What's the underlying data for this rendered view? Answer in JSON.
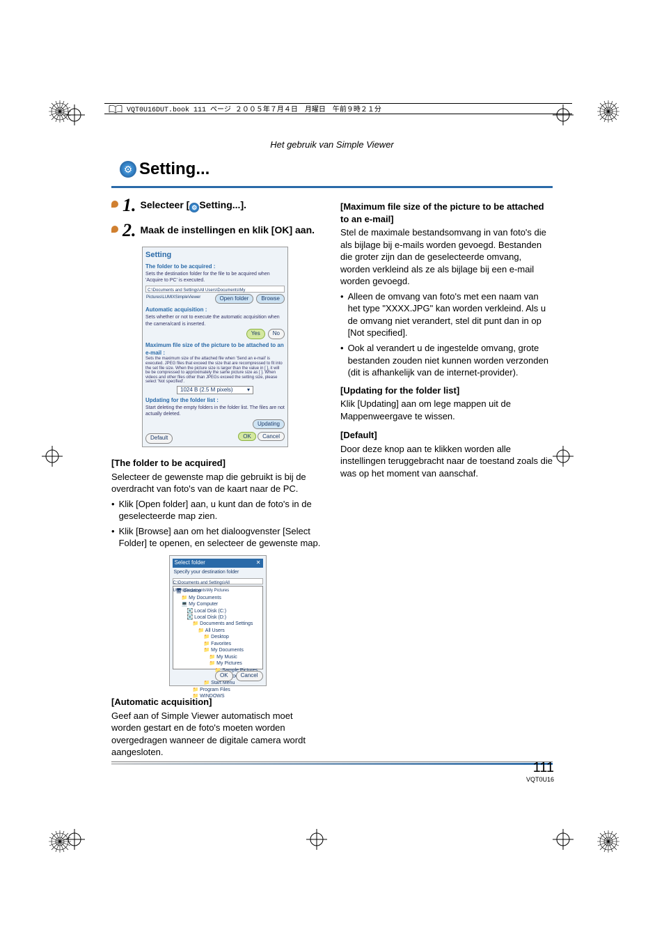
{
  "header": {
    "book_line": "VQT0U16DUT.book  111 ページ  ２００５年７月４日　月曜日　午前９時２１分"
  },
  "page_header": "Het gebruik van Simple Viewer",
  "title": "Setting...",
  "steps": {
    "s1_prefix": "Selecteer [",
    "s1_suffix": "Setting...].",
    "s2": "Maak de instellingen en klik [OK] aan."
  },
  "setting_dialog": {
    "title": "Setting",
    "folder_label": "The folder to be acquired :",
    "folder_desc": "Sets the destination folder for the file to be acquired when 'Acquire to PC' is executed.",
    "path": "C:\\Documents and Settings\\All Users\\Documents\\My Pictures\\LUMIXSimpleViewer",
    "open_folder": "Open folder",
    "browse": "Browse",
    "auto_label": "Automatic acquisition :",
    "auto_desc": "Sets whether or not to execute the automatic acquisition when the camera/card is inserted.",
    "yes": "Yes",
    "no": "No",
    "max_label": "Maximum file size of the picture to be attached to an e-mail :",
    "max_desc": "Sets the maximum size of the attached file when 'Send an e-mail' is executed. JPEG files that exceed the size that are recompressed to fit into the set file size. When the picture size is larger than the value in [ ], it will be be compressed to approximately the same picture size as [ ]. When videos and other files other than JPEGs exceed the setting size, please select 'Not specified'.",
    "size_option": "1024 B (2.5 M pixels)",
    "updating_label": "Updating for the folder list :",
    "updating_desc": "Start deleting the empty folders in the folder list. The files are not actually deleted.",
    "updating_btn": "Updating",
    "default_btn": "Default",
    "ok": "OK",
    "cancel": "Cancel"
  },
  "folder_dialog": {
    "title": "Select folder",
    "instruction": "Specify your destination folder",
    "path": "C:\\Documents and Settings\\All Users\\Documents\\My Pictures",
    "tree": [
      "Desktop",
      "My Documents",
      "My Computer",
      "Local Disk (C:)",
      "Local Disk (D:)",
      "Documents and Settings",
      "All Users",
      "Desktop",
      "Favorites",
      "My Documents",
      "My Music",
      "My Pictures",
      "Sample Pictures",
      "LUMIXSimpl...",
      "Start Menu",
      "Program Files",
      "WINDOWS"
    ],
    "ok": "OK",
    "cancel": "Cancel"
  },
  "left": {
    "h1": "[The folder to be acquired]",
    "p1": "Selecteer de gewenste map die gebruikt is bij de overdracht van foto's van de kaart naar de PC.",
    "b1": "Klik [Open folder] aan, u kunt dan de foto's in de geselecteerde map zien.",
    "b2": "Klik [Browse] aan om het dialoogvenster [Select Folder] te openen, en selecteer de gewenste map.",
    "h2": "[Automatic acquisition]",
    "p2": "Geef aan of Simple Viewer automatisch moet worden gestart en de foto's moeten worden overgedragen wanneer de digitale camera wordt aangesloten."
  },
  "right": {
    "h1": "[Maximum file size of the picture to be attached to an e-mail]",
    "p1": "Stel de maximale bestandsomvang in van foto's die als bijlage bij e-mails worden gevoegd. Bestanden die groter zijn dan de geselecteerde omvang, worden verkleind als ze als bijlage bij een e-mail worden gevoegd.",
    "b1": "Alleen de omvang van foto's met een naam van het type \"XXXX.JPG\" kan worden verkleind. Als u de omvang niet verandert, stel dit punt dan in op [Not specified].",
    "b2": "Ook al verandert u de ingestelde omvang, grote bestanden zouden niet kunnen worden verzonden (dit is afhankelijk van de internet-provider).",
    "h2": "[Updating for the folder list]",
    "p2": "Klik [Updating] aan om lege mappen uit de Mappenweergave te wissen.",
    "h3": "[Default]",
    "p3": "Door deze knop aan te klikken worden alle instellingen teruggebracht naar de toestand zoals die was op het moment van aanschaf."
  },
  "footer": {
    "page": "111",
    "code": "VQT0U16"
  }
}
